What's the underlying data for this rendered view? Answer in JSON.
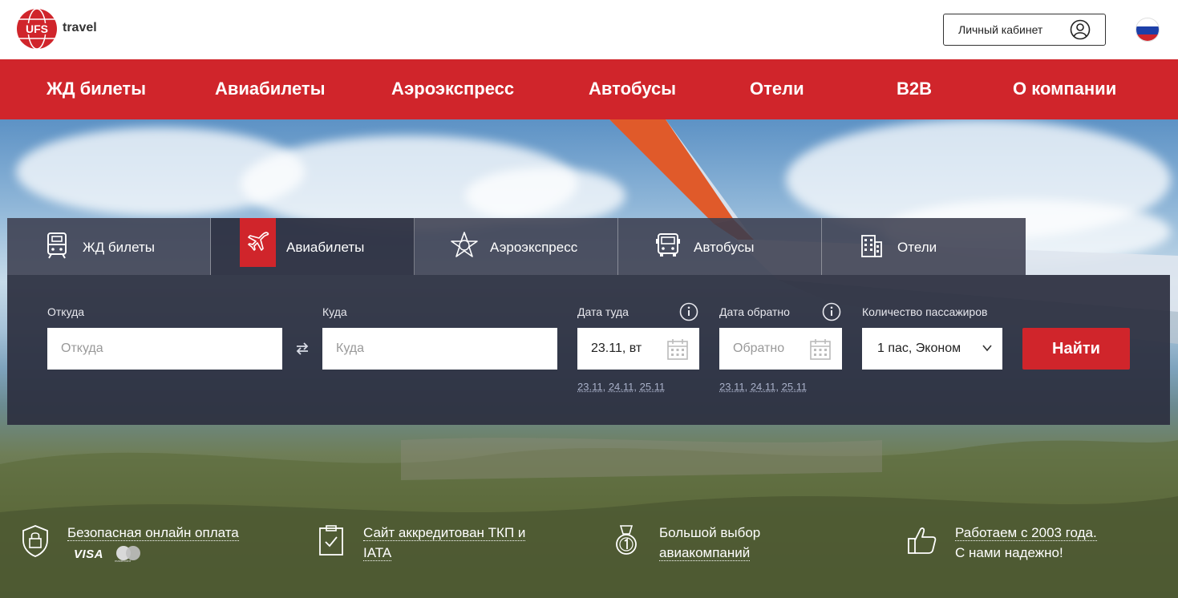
{
  "header": {
    "logo_text": "UFS",
    "logo_suffix": "travel",
    "account_label": "Личный кабинет",
    "language_flag": "russia"
  },
  "nav": {
    "items": [
      {
        "label": "ЖД билеты"
      },
      {
        "label": "Авиабилеты"
      },
      {
        "label": "Аэроэкспресс"
      },
      {
        "label": "Автобусы"
      },
      {
        "label": "Отели"
      },
      {
        "label": "B2B"
      },
      {
        "label": "О компании"
      }
    ]
  },
  "tabs": [
    {
      "label": "ЖД билеты",
      "icon": "train-icon",
      "active": false
    },
    {
      "label": "Авиабилеты",
      "icon": "plane-icon",
      "active": true
    },
    {
      "label": "Аэроэкспресс",
      "icon": "aeroexpress-icon",
      "active": false
    },
    {
      "label": "Автобусы",
      "icon": "bus-icon",
      "active": false
    },
    {
      "label": "Отели",
      "icon": "hotel-icon",
      "active": false
    }
  ],
  "search": {
    "from_label": "Откуда",
    "from_placeholder": "Откуда",
    "to_label": "Куда",
    "to_placeholder": "Куда",
    "depart_label": "Дата туда",
    "depart_value": "23.11, вт",
    "return_label": "Дата обратно",
    "return_placeholder": "Обратно",
    "quick_dates_depart": [
      "23.11",
      "24.11",
      "25.11"
    ],
    "quick_dates_return": [
      "23.11",
      "24.11",
      "25.11"
    ],
    "passengers_label": "Количество пассажиров",
    "passengers_value": "1 пас, Эконом",
    "submit_label": "Найти"
  },
  "features": [
    {
      "line1": "Безопасная онлайн оплата",
      "line2": "",
      "icon": "shield-lock-icon"
    },
    {
      "line1": "Сайт аккредитован ТКП и",
      "line2": "IATA",
      "icon": "certificate-icon"
    },
    {
      "line1": "Большой выбор",
      "line2": "авиакомпаний",
      "icon": "medal-icon"
    },
    {
      "line1": "Работаем с 2003 года.",
      "line2": "С нами надежно!",
      "icon": "thumbs-up-icon"
    }
  ],
  "payments": {
    "visa": "VISA",
    "mastercard": "mastercard"
  },
  "colors": {
    "brand_red": "#d0252b",
    "panel": "#2c2f40"
  }
}
